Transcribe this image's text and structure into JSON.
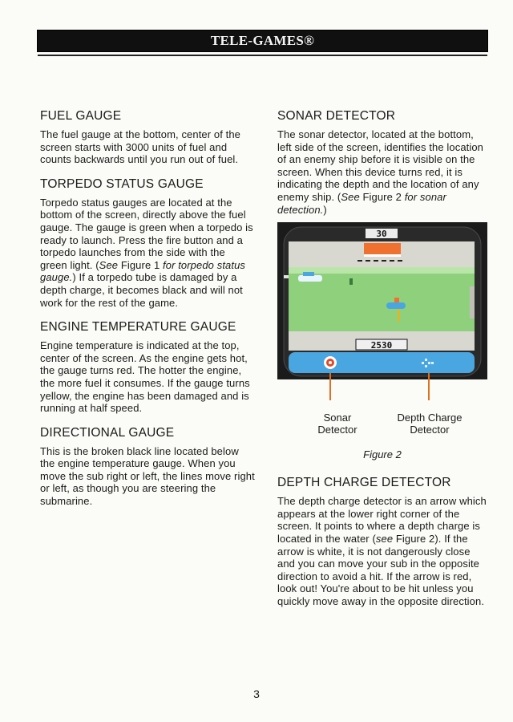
{
  "header": {
    "title": "TELE-GAMES®"
  },
  "left": {
    "fuel": {
      "heading": "FUEL GAUGE",
      "text": "The fuel gauge at the bottom, center of the screen starts with 3000 units of fuel and counts backwards until you run out of fuel."
    },
    "torpedo": {
      "heading": "TORPEDO STATUS GAUGE",
      "t1": "Torpedo status gauges are located at the bottom of the screen, directly above the fuel gauge. The gauge is green when a torpedo is ready to launch. Press the fire button and a torpedo launches from the side with the green light. (",
      "see": "See",
      "figref": " Figure 1 ",
      "forlabel": "for torpedo status gauge.",
      "t2": ") If a torpedo tube is damaged by a depth charge, it becomes black and will not work for the rest of the game."
    },
    "engine": {
      "heading": "ENGINE TEMPERATURE GAUGE",
      "text": "Engine temperature is indicated at the top, center of the screen. As the engine gets hot, the gauge turns red. The hotter the engine, the more fuel it consumes. If the gauge turns yellow, the engine has been damaged and is running at half speed."
    },
    "directional": {
      "heading": "DIRECTIONAL GAUGE",
      "text": "This is the broken black line located below the engine temperature gauge. When you move the sub right or left, the lines move right or left, as though you are steering the submarine."
    }
  },
  "right": {
    "sonar": {
      "heading": "SONAR DETECTOR",
      "t1": "The sonar detector, located at the bottom, left side of the screen, identifies the location of an enemy ship before it is visible on the screen. When this device turns red, it is indicating the depth and the location of any enemy ship. (",
      "see": "See",
      "figref": " Figure 2 ",
      "forlabel": "for sonar detection.",
      "t2": ")"
    },
    "figure": {
      "top_number": "30",
      "fuel_readout": "2530",
      "callout_sonar": [
        "Sonar",
        "Detector"
      ],
      "callout_depth": [
        "Depth Charge",
        "Detector"
      ],
      "caption": "Figure 2"
    },
    "depth": {
      "heading": "DEPTH CHARGE DETECTOR",
      "t1": "The depth charge detector is an arrow which appears at the lower right corner of the screen. It points to where a depth charge is located in the water (",
      "see": "see",
      "figref": " Figure 2",
      "t2": "). If the arrow is white, it is not dangerously close and you can move your sub in the opposite direction to avoid a hit. If the arrow is red, look out! You're about to be hit unless you quickly move away in the opposite direction."
    }
  },
  "footer": {
    "page": "3"
  },
  "colors": {
    "screen_green": "#8fd07c",
    "screen_gray": "#d8d8d0",
    "hud_blue": "#4aa6e0",
    "engine_orange": "#f07030",
    "callout_orange": "#e07020"
  }
}
